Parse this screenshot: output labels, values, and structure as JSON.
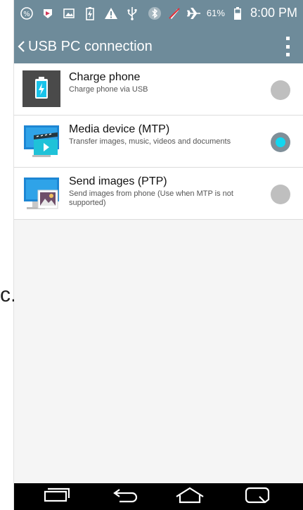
{
  "outside": {
    "glyph": "c."
  },
  "status_bar": {
    "battery_percent": "61%",
    "time": "8:00 PM",
    "icons_left": [
      "percent-icon",
      "app-notification-icon",
      "image-icon",
      "battery-charging-icon",
      "warning-icon",
      "usb-icon"
    ],
    "icons_right": [
      "bluetooth-icon",
      "mute-icon",
      "airplane-icon",
      "battery-icon"
    ]
  },
  "app_bar": {
    "title": "USB PC connection",
    "back_icon": "chevron-left-icon",
    "overflow_icon": "overflow-menu-icon"
  },
  "options": [
    {
      "title": "Charge phone",
      "subtitle": "Charge phone via USB",
      "icon": "charge-phone-icon",
      "selected": false
    },
    {
      "title": "Media device (MTP)",
      "subtitle": "Transfer images, music, videos and documents",
      "icon": "media-device-icon",
      "selected": true
    },
    {
      "title": "Send images (PTP)",
      "subtitle": "Send images from phone (Use when MTP is not supported)",
      "icon": "send-images-icon",
      "selected": false
    }
  ],
  "nav_bar": {
    "buttons": [
      "recent-apps-icon",
      "back-icon",
      "home-icon",
      "menu-icon"
    ]
  },
  "colors": {
    "header": "#6e8b9a",
    "radio_selected": "#12d6f0",
    "radio_unselected": "#bfbfbf"
  }
}
